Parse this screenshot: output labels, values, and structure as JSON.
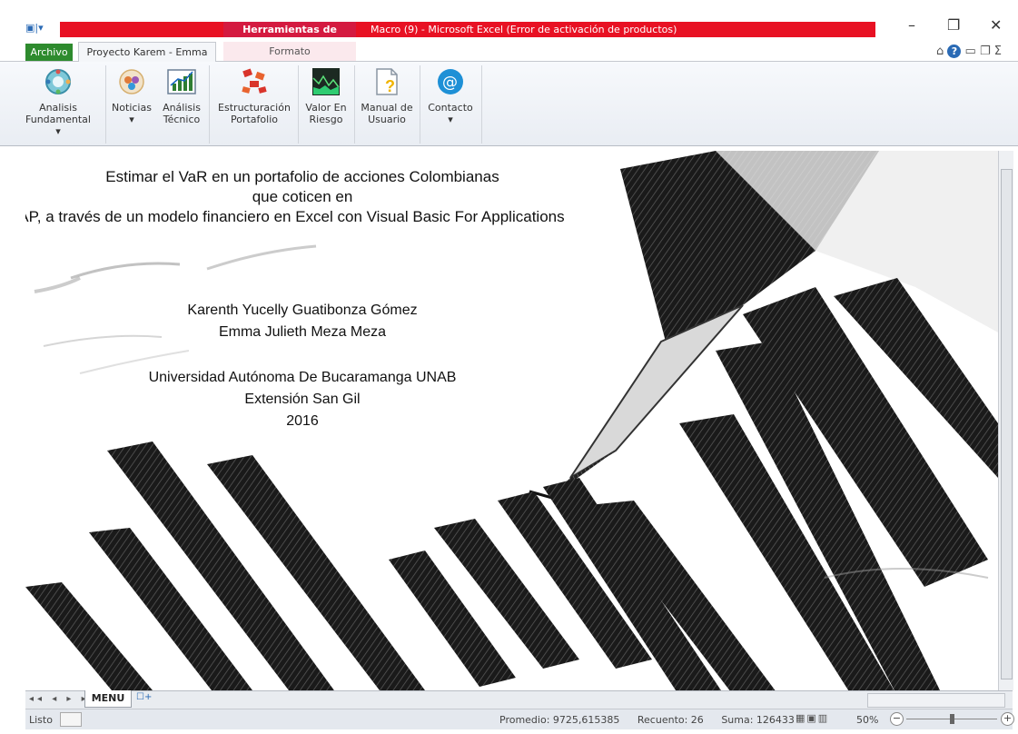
{
  "window": {
    "title": "Macro (9)  -  Microsoft Excel (Error de activación de productos)",
    "context_tab_group": "Herramientas de imagen",
    "minimize": "–",
    "restore": "❐",
    "close": "✕"
  },
  "tabs": {
    "file": "Archivo",
    "active": "Proyecto Karem - Emma",
    "formato": "Formato"
  },
  "ribbon": {
    "buttons": [
      {
        "label1": "Analisis",
        "label2": "Fundamental ▾",
        "icon": "globe-icon"
      },
      {
        "label1": "Noticias",
        "label2": "▾",
        "icon": "news-icon"
      },
      {
        "label1": "Análisis",
        "label2": "Técnico",
        "icon": "chart-icon"
      },
      {
        "label1": "Estructuración",
        "label2": "Portafolio",
        "icon": "structure-icon"
      },
      {
        "label1": "Valor En",
        "label2": "Riesgo",
        "icon": "risk-chart-icon"
      },
      {
        "label1": "Manual de",
        "label2": "Usuario",
        "icon": "manual-icon"
      },
      {
        "label1": "Contacto",
        "label2": "▾",
        "icon": "at-icon"
      }
    ],
    "colors": {
      "contact": "#1e90d6",
      "structure": "#d9342b"
    }
  },
  "slide": {
    "line1": "Estimar el VaR en un portafolio de acciones Colombianas",
    "line2": "que coticen en",
    "line3": "CAP, a través de un modelo financiero en Excel con Visual Basic For Applications",
    "author1": "Karenth Yucelly Guatibonza Gómez",
    "author2": "Emma Julieth Meza Meza",
    "university": "Universidad Autónoma De Bucaramanga UNAB",
    "campus": "Extensión San Gil",
    "year": "2016"
  },
  "sheets": {
    "active": "MENU"
  },
  "status": {
    "ready": "Listo",
    "promedio": "Promedio: 9725,615385",
    "recuento": "Recuento: 26",
    "suma": "Suma: 126433",
    "zoom": "50%"
  }
}
